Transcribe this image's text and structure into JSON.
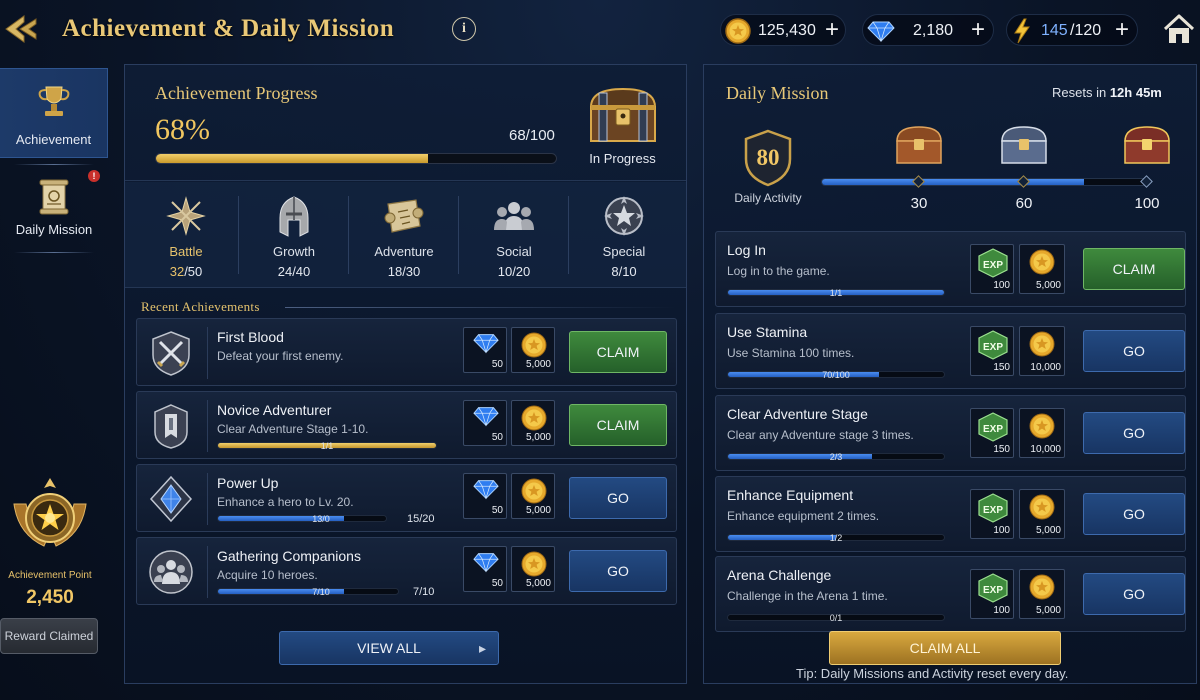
{
  "header": {
    "title": "Achievement & Daily Mission",
    "info": "i",
    "currencies": [
      {
        "icon": "gold-coin-icon",
        "value": "125,430"
      },
      {
        "icon": "diamond-icon",
        "value": "2,180"
      },
      {
        "icon": "lightning-icon",
        "value_current": "145",
        "value_max": "/120"
      }
    ],
    "plus": "+"
  },
  "sidebar": {
    "tabs": [
      {
        "label": "Achievement",
        "active": true
      },
      {
        "label": "Daily Mission",
        "badge": "!"
      }
    ],
    "achievement_point_label": "Achievement Point",
    "achievement_point_value": "2,450",
    "reward_claimed": "Reward Claimed"
  },
  "achievement_progress": {
    "title": "Achievement Progress",
    "percent_text": "68%",
    "percent": 0.68,
    "count": "68/100",
    "chest_status": "In Progress"
  },
  "categories": [
    {
      "name": "Battle",
      "current": "32",
      "total": "/50",
      "active": true
    },
    {
      "name": "Growth",
      "current": "24",
      "total": "/40"
    },
    {
      "name": "Adventure",
      "current": "18",
      "total": "/30"
    },
    {
      "name": "Social",
      "current": "10",
      "total": "/20"
    },
    {
      "name": "Special",
      "current": "8",
      "total": "/10"
    }
  ],
  "recent": {
    "title": "Recent Achievements",
    "items": [
      {
        "name": "First Blood",
        "desc": "Defeat your first enemy.",
        "rewards": [
          "50",
          "5,000"
        ],
        "button": "CLAIM",
        "status": "claim"
      },
      {
        "name": "Novice Adventurer",
        "desc": "Clear Adventure Stage 1-10.",
        "progress_text": "1/1",
        "progress": 1.0,
        "rewards": [
          "50",
          "5,000"
        ],
        "button": "CLAIM",
        "status": "claim"
      },
      {
        "name": "Power Up",
        "desc": "Enhance a hero to Lv. 20.",
        "progress_text": "13/0",
        "progress_right": "15/20",
        "progress": 0.75,
        "rewards": [
          "50",
          "5,000"
        ],
        "button": "GO",
        "status": "go"
      },
      {
        "name": "Gathering Companions",
        "desc": "Acquire 10 heroes.",
        "progress_text": "7/10",
        "progress_right": "7/10",
        "progress": 0.7,
        "rewards": [
          "50",
          "5,000"
        ],
        "button": "GO",
        "status": "go"
      }
    ],
    "view_all": "VIEW ALL"
  },
  "daily": {
    "title": "Daily Mission",
    "reset_prefix": "Resets in",
    "reset_time": "12h 45m",
    "activity_value": "80",
    "activity_label": "Daily Activity",
    "activity_progress": 0.8,
    "milestones": [
      "30",
      "60",
      "100"
    ],
    "missions": [
      {
        "name": "Log In",
        "desc": "Log in to the game.",
        "progress_text": "1/1",
        "progress": 1.0,
        "exp": "100",
        "gold": "5,000",
        "button": "CLAIM",
        "status": "claim"
      },
      {
        "name": "Use Stamina",
        "desc": "Use Stamina 100 times.",
        "progress_text": "70/100",
        "progress": 0.7,
        "exp": "150",
        "gold": "10,000",
        "button": "GO",
        "status": "go"
      },
      {
        "name": "Clear Adventure Stage",
        "desc": "Clear any Adventure stage 3 times.",
        "progress_text": "2/3",
        "progress": 0.6667,
        "exp": "150",
        "gold": "10,000",
        "button": "GO",
        "status": "go"
      },
      {
        "name": "Enhance Equipment",
        "desc": "Enhance equipment 2 times.",
        "progress_text": "1/2",
        "progress": 0.5,
        "exp": "100",
        "gold": "5,000",
        "button": "GO",
        "status": "go"
      },
      {
        "name": "Arena Challenge",
        "desc": "Challenge in the Arena 1 time.",
        "progress_text": "0/1",
        "progress": 0.0,
        "exp": "100",
        "gold": "5,000",
        "button": "GO",
        "status": "go"
      }
    ],
    "claim_all": "CLAIM ALL",
    "tip": "Tip: Daily Missions and Activity reset every day."
  },
  "colors": {
    "gold": "#e8c26a",
    "claim_green": "#3f8a3d",
    "go_blue": "#234a82",
    "progress_blue": "#3a7ae0"
  }
}
